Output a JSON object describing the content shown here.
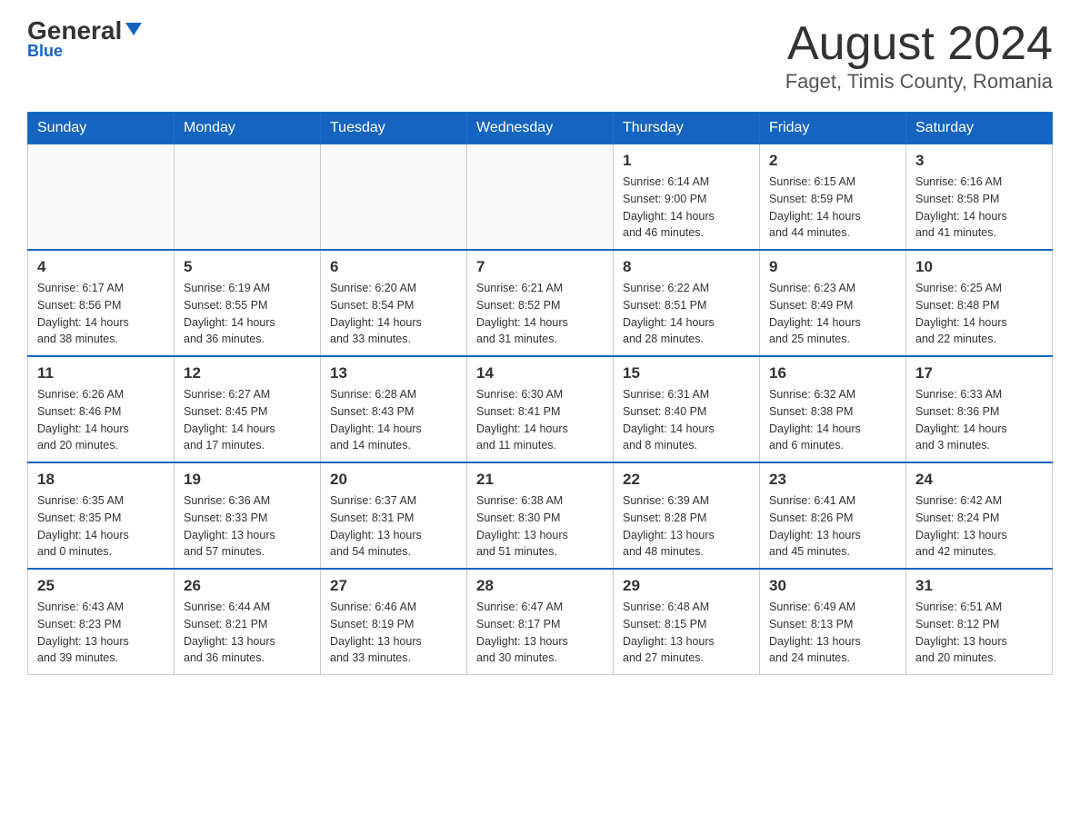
{
  "logo": {
    "text_general": "General",
    "text_blue": "Blue"
  },
  "header": {
    "main_title": "August 2024",
    "subtitle": "Faget, Timis County, Romania"
  },
  "calendar": {
    "days_of_week": [
      "Sunday",
      "Monday",
      "Tuesday",
      "Wednesday",
      "Thursday",
      "Friday",
      "Saturday"
    ],
    "weeks": [
      [
        {
          "day": "",
          "info": ""
        },
        {
          "day": "",
          "info": ""
        },
        {
          "day": "",
          "info": ""
        },
        {
          "day": "",
          "info": ""
        },
        {
          "day": "1",
          "info": "Sunrise: 6:14 AM\nSunset: 9:00 PM\nDaylight: 14 hours\nand 46 minutes."
        },
        {
          "day": "2",
          "info": "Sunrise: 6:15 AM\nSunset: 8:59 PM\nDaylight: 14 hours\nand 44 minutes."
        },
        {
          "day": "3",
          "info": "Sunrise: 6:16 AM\nSunset: 8:58 PM\nDaylight: 14 hours\nand 41 minutes."
        }
      ],
      [
        {
          "day": "4",
          "info": "Sunrise: 6:17 AM\nSunset: 8:56 PM\nDaylight: 14 hours\nand 38 minutes."
        },
        {
          "day": "5",
          "info": "Sunrise: 6:19 AM\nSunset: 8:55 PM\nDaylight: 14 hours\nand 36 minutes."
        },
        {
          "day": "6",
          "info": "Sunrise: 6:20 AM\nSunset: 8:54 PM\nDaylight: 14 hours\nand 33 minutes."
        },
        {
          "day": "7",
          "info": "Sunrise: 6:21 AM\nSunset: 8:52 PM\nDaylight: 14 hours\nand 31 minutes."
        },
        {
          "day": "8",
          "info": "Sunrise: 6:22 AM\nSunset: 8:51 PM\nDaylight: 14 hours\nand 28 minutes."
        },
        {
          "day": "9",
          "info": "Sunrise: 6:23 AM\nSunset: 8:49 PM\nDaylight: 14 hours\nand 25 minutes."
        },
        {
          "day": "10",
          "info": "Sunrise: 6:25 AM\nSunset: 8:48 PM\nDaylight: 14 hours\nand 22 minutes."
        }
      ],
      [
        {
          "day": "11",
          "info": "Sunrise: 6:26 AM\nSunset: 8:46 PM\nDaylight: 14 hours\nand 20 minutes."
        },
        {
          "day": "12",
          "info": "Sunrise: 6:27 AM\nSunset: 8:45 PM\nDaylight: 14 hours\nand 17 minutes."
        },
        {
          "day": "13",
          "info": "Sunrise: 6:28 AM\nSunset: 8:43 PM\nDaylight: 14 hours\nand 14 minutes."
        },
        {
          "day": "14",
          "info": "Sunrise: 6:30 AM\nSunset: 8:41 PM\nDaylight: 14 hours\nand 11 minutes."
        },
        {
          "day": "15",
          "info": "Sunrise: 6:31 AM\nSunset: 8:40 PM\nDaylight: 14 hours\nand 8 minutes."
        },
        {
          "day": "16",
          "info": "Sunrise: 6:32 AM\nSunset: 8:38 PM\nDaylight: 14 hours\nand 6 minutes."
        },
        {
          "day": "17",
          "info": "Sunrise: 6:33 AM\nSunset: 8:36 PM\nDaylight: 14 hours\nand 3 minutes."
        }
      ],
      [
        {
          "day": "18",
          "info": "Sunrise: 6:35 AM\nSunset: 8:35 PM\nDaylight: 14 hours\nand 0 minutes."
        },
        {
          "day": "19",
          "info": "Sunrise: 6:36 AM\nSunset: 8:33 PM\nDaylight: 13 hours\nand 57 minutes."
        },
        {
          "day": "20",
          "info": "Sunrise: 6:37 AM\nSunset: 8:31 PM\nDaylight: 13 hours\nand 54 minutes."
        },
        {
          "day": "21",
          "info": "Sunrise: 6:38 AM\nSunset: 8:30 PM\nDaylight: 13 hours\nand 51 minutes."
        },
        {
          "day": "22",
          "info": "Sunrise: 6:39 AM\nSunset: 8:28 PM\nDaylight: 13 hours\nand 48 minutes."
        },
        {
          "day": "23",
          "info": "Sunrise: 6:41 AM\nSunset: 8:26 PM\nDaylight: 13 hours\nand 45 minutes."
        },
        {
          "day": "24",
          "info": "Sunrise: 6:42 AM\nSunset: 8:24 PM\nDaylight: 13 hours\nand 42 minutes."
        }
      ],
      [
        {
          "day": "25",
          "info": "Sunrise: 6:43 AM\nSunset: 8:23 PM\nDaylight: 13 hours\nand 39 minutes."
        },
        {
          "day": "26",
          "info": "Sunrise: 6:44 AM\nSunset: 8:21 PM\nDaylight: 13 hours\nand 36 minutes."
        },
        {
          "day": "27",
          "info": "Sunrise: 6:46 AM\nSunset: 8:19 PM\nDaylight: 13 hours\nand 33 minutes."
        },
        {
          "day": "28",
          "info": "Sunrise: 6:47 AM\nSunset: 8:17 PM\nDaylight: 13 hours\nand 30 minutes."
        },
        {
          "day": "29",
          "info": "Sunrise: 6:48 AM\nSunset: 8:15 PM\nDaylight: 13 hours\nand 27 minutes."
        },
        {
          "day": "30",
          "info": "Sunrise: 6:49 AM\nSunset: 8:13 PM\nDaylight: 13 hours\nand 24 minutes."
        },
        {
          "day": "31",
          "info": "Sunrise: 6:51 AM\nSunset: 8:12 PM\nDaylight: 13 hours\nand 20 minutes."
        }
      ]
    ]
  }
}
